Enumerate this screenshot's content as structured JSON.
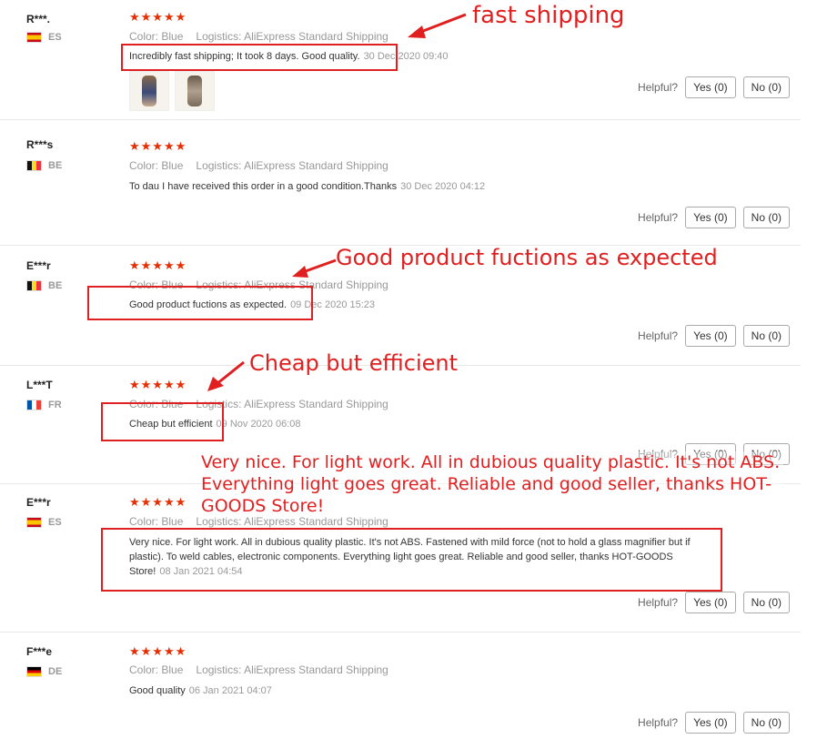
{
  "reviews": [
    {
      "user": "R***.",
      "country": "ES",
      "stars": "★★★★★",
      "color_key": "Color:",
      "color": "Blue",
      "logistics_key": "Logistics:",
      "logistics": "AliExpress Standard Shipping",
      "text": "Incredibly fast shipping; It took 8 days. Good quality.",
      "date": "30 Dec 2020 09:40",
      "helpful": "Helpful?",
      "yes": "Yes (0)",
      "no": "No (0)"
    },
    {
      "user": "R***s",
      "country": "BE",
      "stars": "★★★★★",
      "color_key": "Color:",
      "color": "Blue",
      "logistics_key": "Logistics:",
      "logistics": "AliExpress Standard Shipping",
      "text": "To dau I have received this order in a good condition.Thanks",
      "date": "30 Dec 2020 04:12",
      "helpful": "Helpful?",
      "yes": "Yes (0)",
      "no": "No (0)"
    },
    {
      "user": "E***r",
      "country": "BE",
      "stars": "★★★★★",
      "color_key": "Color:",
      "color": "Blue",
      "logistics_key": "Logistics:",
      "logistics": "AliExpress Standard Shipping",
      "text": "Good product fuctions as expected.",
      "date": "09 Dec 2020 15:23",
      "helpful": "Helpful?",
      "yes": "Yes (0)",
      "no": "No (0)"
    },
    {
      "user": "L***T",
      "country": "FR",
      "stars": "★★★★★",
      "color_key": "Color:",
      "color": "Blue",
      "logistics_key": "Logistics:",
      "logistics": "AliExpress Standard Shipping",
      "text": "Cheap but efficient",
      "date": "09 Nov 2020 06:08",
      "helpful": "Helpful?",
      "yes": "Yes (0)",
      "no": "No (0)"
    },
    {
      "user": "E***r",
      "country": "ES",
      "stars": "★★★★★",
      "color_key": "Color:",
      "color": "Blue",
      "logistics_key": "Logistics:",
      "logistics": "AliExpress Standard Shipping",
      "text": "Very nice. For light work. All in dubious quality plastic. It's not ABS. Fastened with mild force (not to hold a glass magnifier but if plastic). To weld cables, electronic components. Everything light goes great. Reliable and good seller, thanks HOT-GOODS Store!",
      "date": "08 Jan 2021 04:54",
      "helpful": "Helpful?",
      "yes": "Yes (0)",
      "no": "No (0)"
    },
    {
      "user": "F***e",
      "country": "DE",
      "stars": "★★★★★",
      "color_key": "Color:",
      "color": "Blue",
      "logistics_key": "Logistics:",
      "logistics": "AliExpress Standard Shipping",
      "text": "Good quality",
      "date": "06 Jan 2021 04:07",
      "helpful": "Helpful?",
      "yes": "Yes (0)",
      "no": "No (0)"
    }
  ],
  "annotations": {
    "a1": "fast shipping",
    "a2": "Good product fuctions as expected",
    "a3": "Cheap but efficient",
    "a4": "Very nice. For light work. All in dubious quality plastic. It's not ABS. Everything light goes great. Reliable and good seller, thanks HOT-GOODS Store!"
  },
  "colors": {
    "star": "#e62e04",
    "annotation": "#e02020"
  }
}
